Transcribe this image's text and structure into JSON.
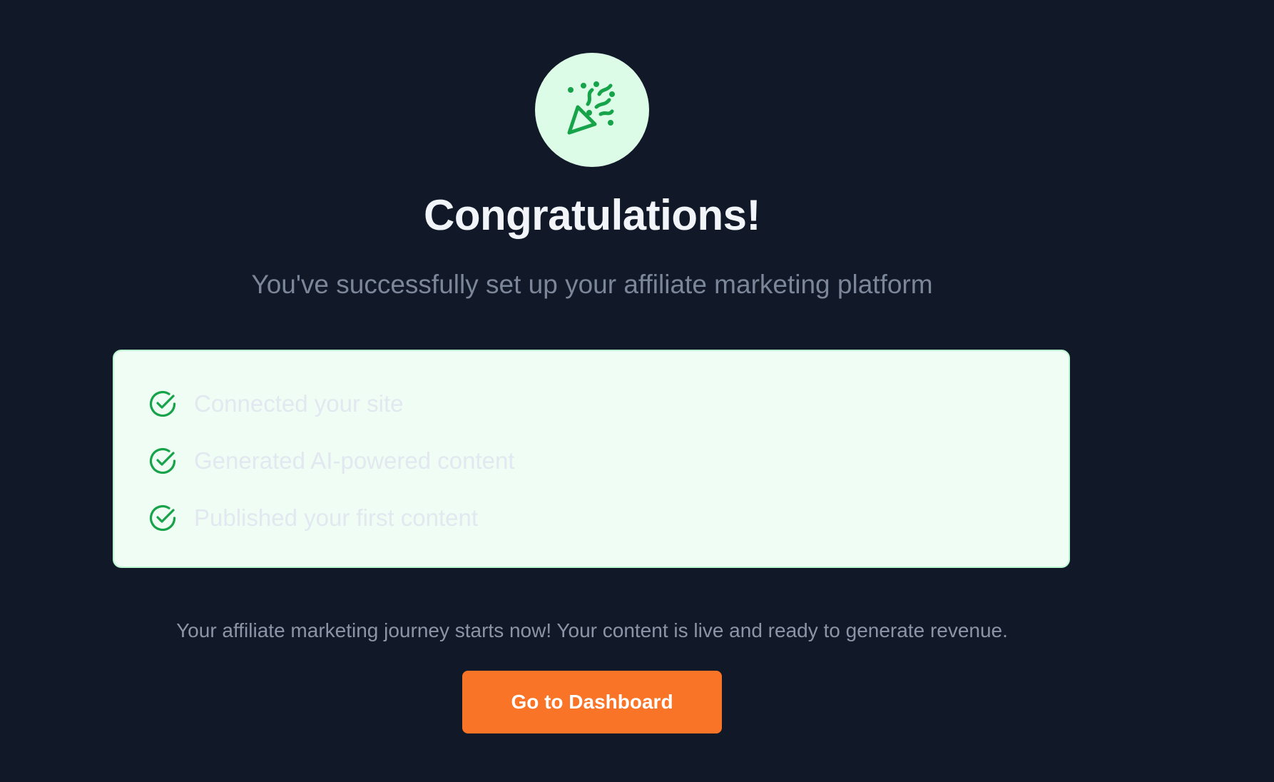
{
  "hero": {
    "icon": "party-popper-icon",
    "title": "Congratulations!",
    "subtitle": "You've successfully set up your affiliate marketing platform"
  },
  "checklist": {
    "items": [
      {
        "icon": "check-circle-icon",
        "label": "Connected your site"
      },
      {
        "icon": "check-circle-icon",
        "label": "Generated AI-powered content"
      },
      {
        "icon": "check-circle-icon",
        "label": "Published your first content"
      }
    ]
  },
  "footer": {
    "message": "Your affiliate marketing journey starts now! Your content is live and ready to generate revenue.",
    "button_label": "Go to Dashboard"
  },
  "colors": {
    "background": "#111827",
    "accent_green": "#16a34a",
    "card_background": "#f0fdf4",
    "button": "#f97427"
  }
}
